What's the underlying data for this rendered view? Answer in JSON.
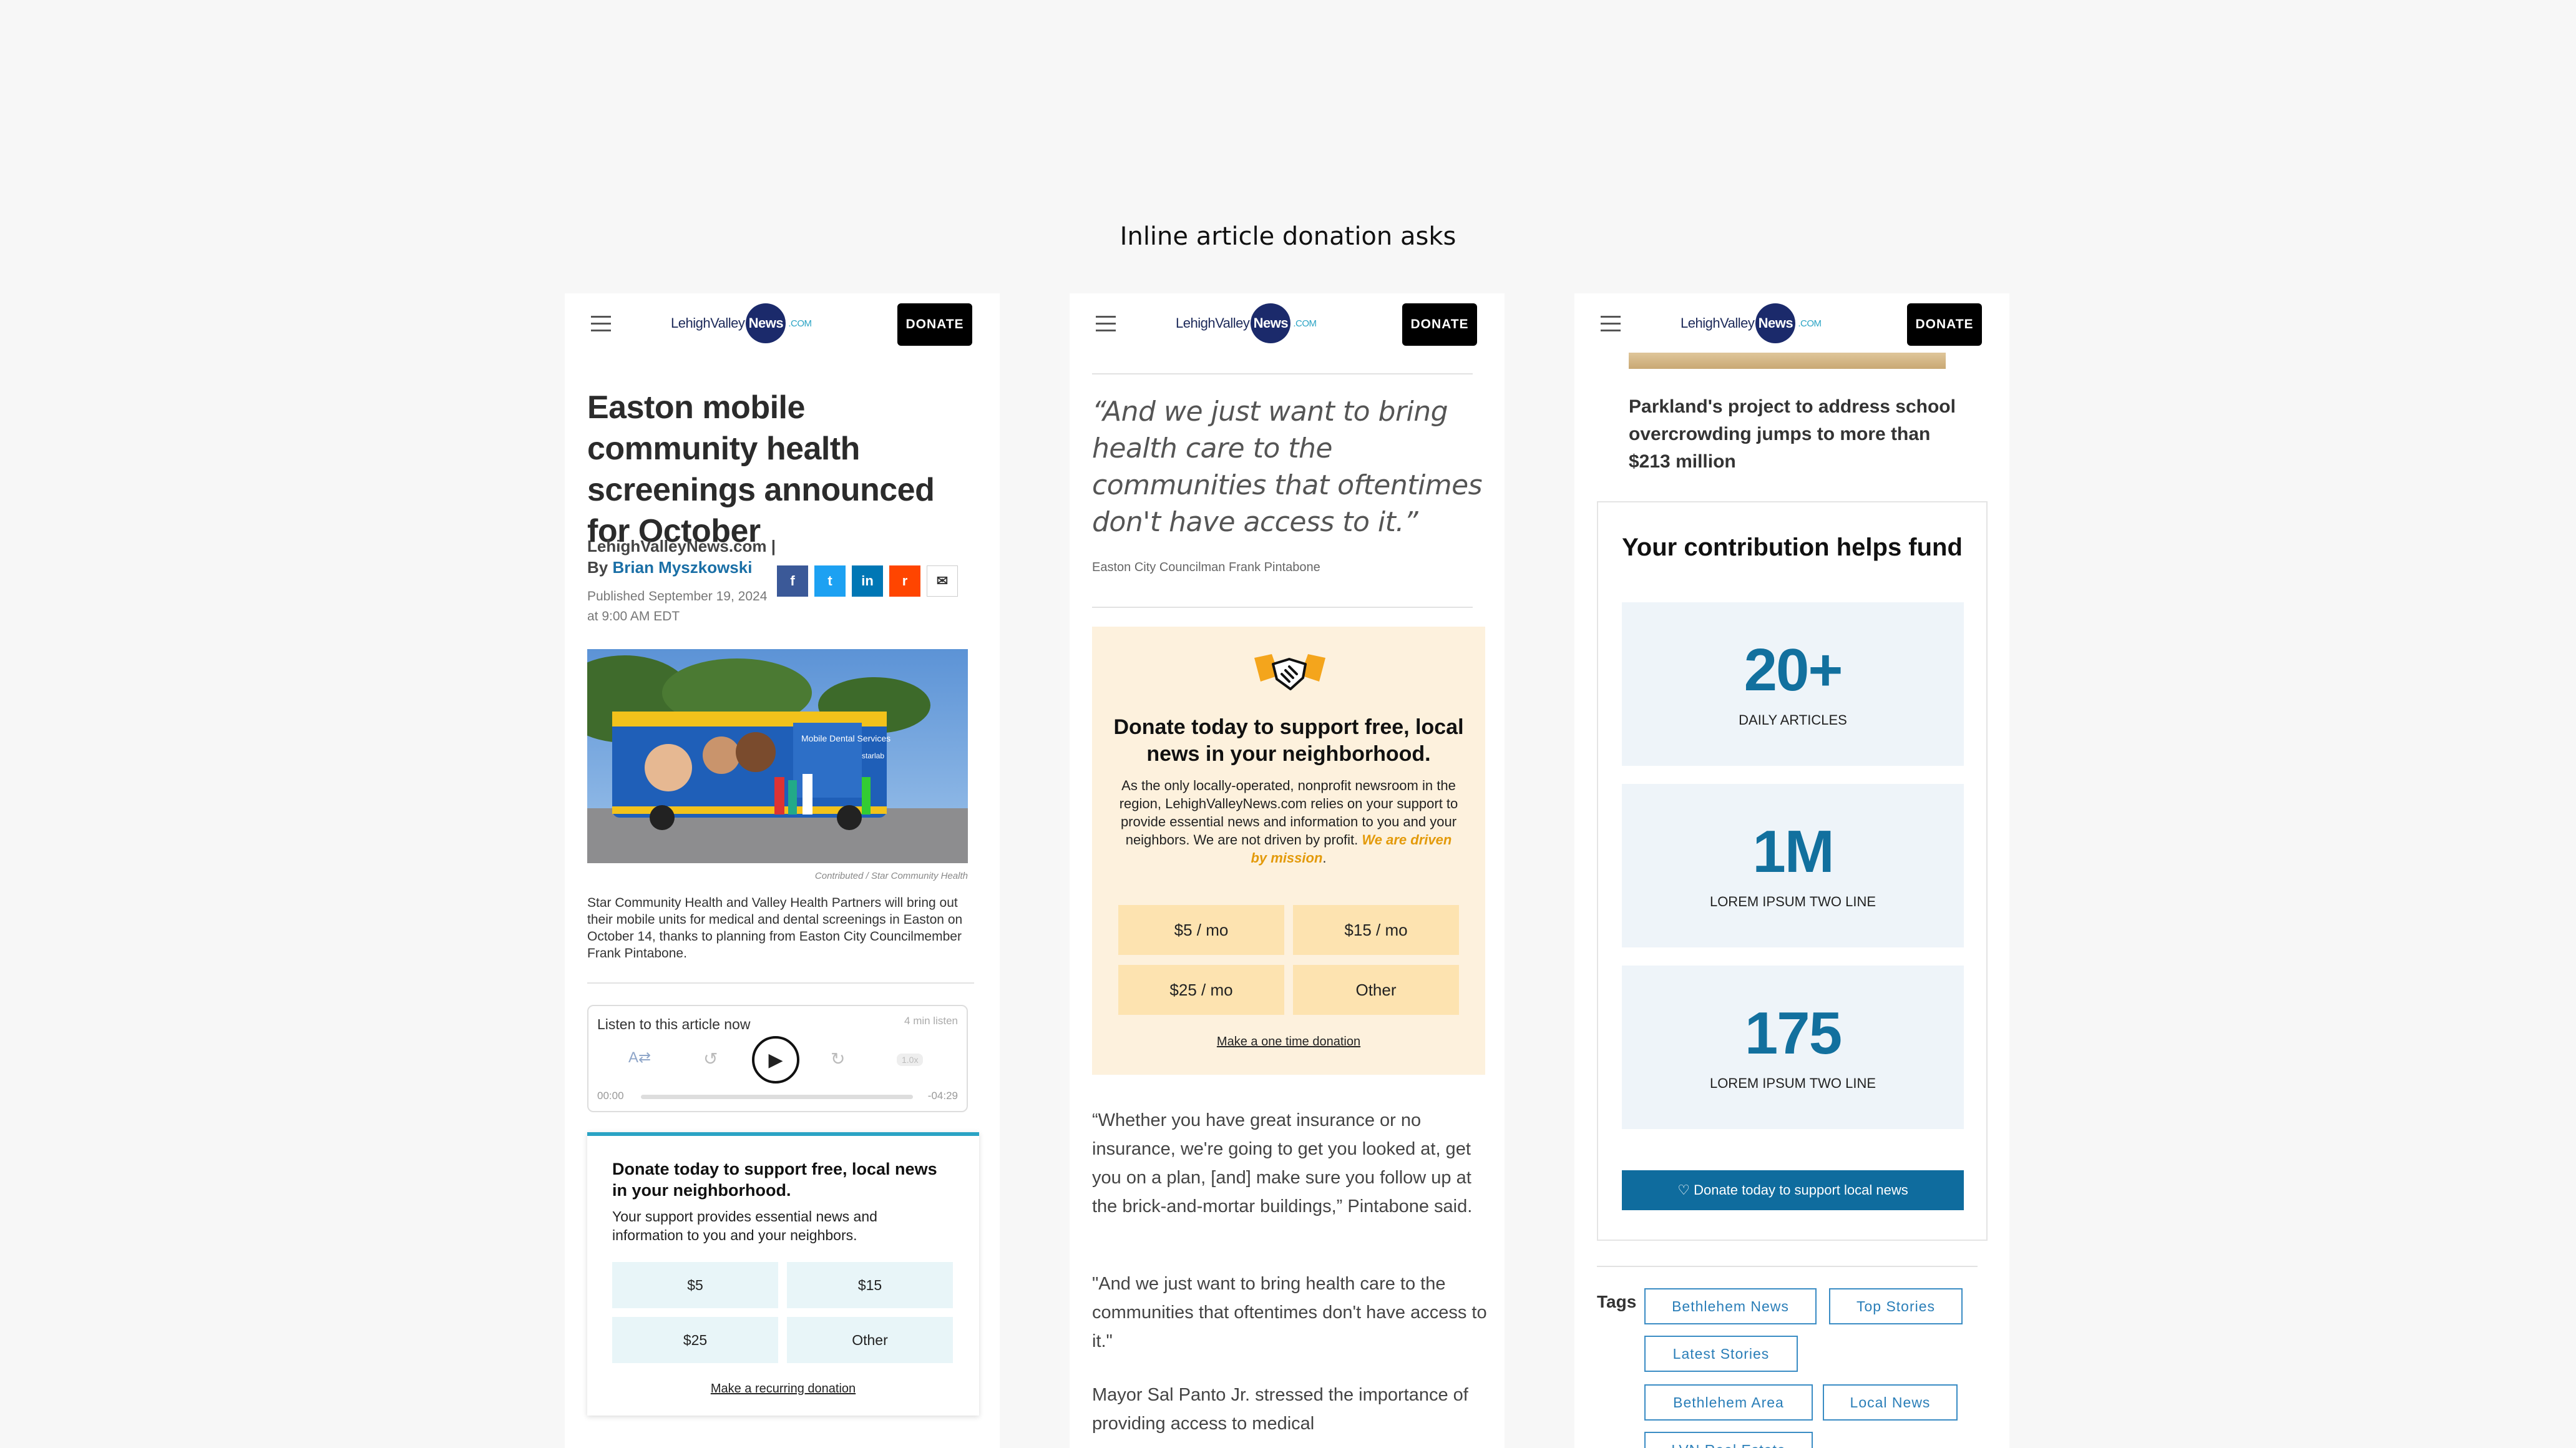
{
  "page_title": "Inline article donation asks",
  "header": {
    "logo_lehigh": "LehighValley",
    "logo_news": "News",
    "logo_com": ".COM",
    "donate": "DONATE"
  },
  "phone1": {
    "headline": "Easton mobile community health screenings announced for October",
    "byline_outlet": "LehighValleyNews.com |",
    "byline_by": "By",
    "author": "Brian Myszkowski",
    "published": "Published September 19, 2024",
    "published_time": "at 9:00 AM EDT",
    "share": {
      "fb": "f",
      "tw": "t",
      "li": "in",
      "rd": "r",
      "em": "✉"
    },
    "photo_credit": "Contributed  /  Star Community Health",
    "photo_text": {
      "bus": "Mobile Dental Services",
      "brand": "starlab"
    },
    "caption": "Star Community Health and Valley Health Partners will bring out their mobile units for medical and dental screenings in Easton on October 14, thanks to planning from Easton City Councilmember Frank Pintabone.",
    "audio": {
      "title": "Listen to this article now",
      "length": "4 min listen",
      "start": "00:00",
      "end": "-04:29",
      "speed": "1.0x"
    },
    "ask": {
      "heading": "Donate today to support free, local news in your neighborhood.",
      "body": "Your support provides essential news and information to you and your neighbors.",
      "amounts": [
        "$5",
        "$15",
        "$25",
        "Other"
      ],
      "link": "Make a recurring donation"
    }
  },
  "phone2": {
    "quote": "“And we just want to bring health care to the communities that oftentimes don't have access to it.”",
    "quote_by": "Easton City Councilman Frank Pintabone",
    "ask": {
      "heading": "Donate today to support free, local news in your neighborhood.",
      "body": "As the only locally-operated, nonprofit newsroom in the region, LehighValleyNews.com relies on your support to provide essential news and information to you and your neighbors. We are not driven by profit.",
      "mission": "We are driven by mission",
      "amounts": [
        "$5 / mo",
        "$15 / mo",
        "$25 / mo",
        "Other"
      ],
      "link": "Make a one time donation"
    },
    "paragraphs": [
      "“Whether you have great insurance or no insurance, we're going to get you looked at, get you on a plan, [and] make sure you follow up at the brick-and-mortar buildings,” Pintabone said.",
      "\"And we just want to bring health care to the communities that oftentimes don't have access to it.\"",
      "Mayor Sal Panto Jr. stressed the importance of providing access to medical"
    ]
  },
  "phone3": {
    "story_title": "Parkland's project to address school overcrowding jumps to more than $213 million",
    "impact": {
      "heading": "Your contribution helps fund",
      "stats": [
        {
          "num": "20+",
          "label": "DAILY ARTICLES"
        },
        {
          "num": "1M",
          "label": "LOREM IPSUM TWO LINE"
        },
        {
          "num": "175",
          "label": "LOREM IPSUM TWO LINE"
        }
      ],
      "button": "♡ Donate today to support local news"
    },
    "tags_label": "Tags",
    "tags": [
      "Bethlehem News",
      "Top Stories",
      "Latest Stories",
      "Bethlehem Area",
      "Local News",
      "LVN Real Estate"
    ]
  },
  "colors": {
    "accent_teal": "#2aa3c4",
    "donate_cream": "#fdf1dd",
    "stat_blue": "#12709e",
    "button_blue": "#0f6c9e"
  }
}
